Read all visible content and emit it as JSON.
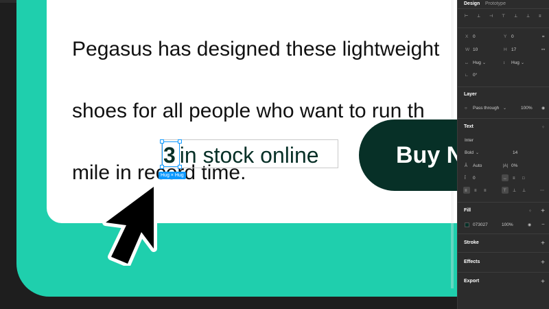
{
  "canvas": {
    "paragraph_lines": [
      "Pegasus has designed these lightweight",
      "shoes for all people who want to run th",
      "mile in record time."
    ],
    "stock_number": "3",
    "stock_text": "in stock online",
    "size_badge": "Hug × Hug",
    "buy_button_label": "Buy N",
    "colors": {
      "teal": "#1fcfad",
      "dark_green": "#073027",
      "selection": "#0d99ff"
    }
  },
  "panel": {
    "tabs": {
      "design": "Design",
      "prototype": "Prototype"
    },
    "position": {
      "x_label": "X",
      "x_value": "0",
      "y_label": "Y",
      "y_value": "0"
    },
    "size": {
      "w_label": "W",
      "w_value": "10",
      "h_label": "H",
      "h_value": "17"
    },
    "resizing": {
      "horizontal": "Hug",
      "vertical": "Hug"
    },
    "rotation": "0°",
    "layer": {
      "title": "Layer",
      "blend_mode": "Pass through",
      "opacity": "100%"
    },
    "text": {
      "title": "Text",
      "font_family": "Inter",
      "font_weight": "Bold",
      "font_size": "14",
      "line_height": "Auto",
      "letter_spacing": "0%",
      "paragraph_spacing": "0"
    },
    "fill": {
      "title": "Fill",
      "hex": "073027",
      "opacity": "100%",
      "color": "#073027"
    },
    "stroke": {
      "title": "Stroke"
    },
    "effects": {
      "title": "Effects"
    },
    "export": {
      "title": "Export"
    }
  }
}
